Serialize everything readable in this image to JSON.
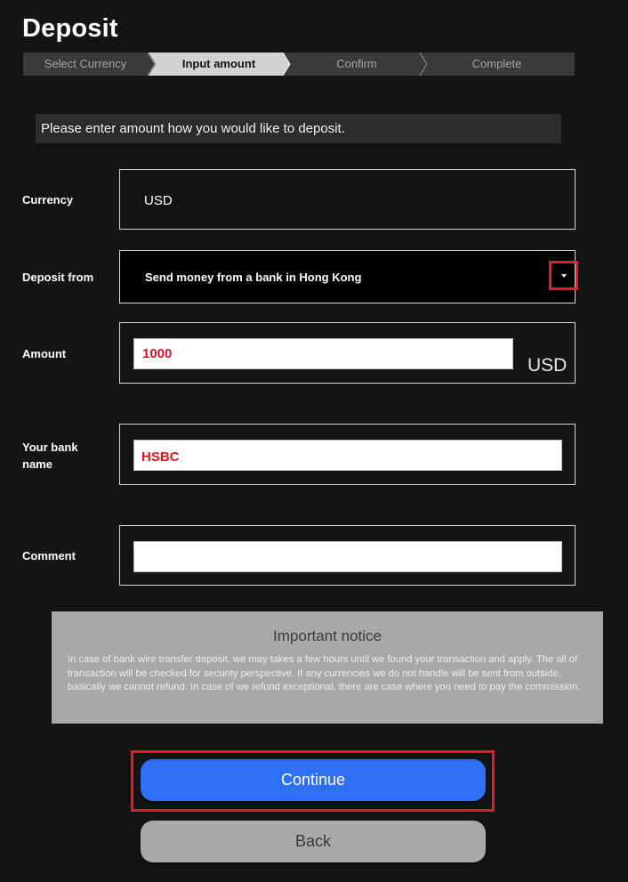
{
  "page": {
    "title": "Deposit"
  },
  "steps": [
    {
      "label": "Select Currency",
      "active": false
    },
    {
      "label": "Input amount",
      "active": true
    },
    {
      "label": "Confirm",
      "active": false
    },
    {
      "label": "Complete",
      "active": false
    }
  ],
  "instruction": "Please enter amount how you would like to deposit.",
  "form": {
    "currency": {
      "label": "Currency",
      "value": "USD"
    },
    "deposit_from": {
      "label": "Deposit from",
      "selected": "Send money from a bank in Hong Kong"
    },
    "amount": {
      "label": "Amount",
      "value": "1000",
      "unit": "USD"
    },
    "bank_name": {
      "label_line1": "Your bank",
      "label_line2": "name",
      "value": "HSBC"
    },
    "comment": {
      "label": "Comment",
      "value": ""
    }
  },
  "notice": {
    "title": "Important notice",
    "body": "In case of bank wire transfer deposit, we may takes a few hours until we found your transaction and apply. The all of transaction will be checked for security perspective. If any currencies we do not handle will be sent from outside, basically we cannot refund. In case of we refund exceptional, there are case where you need to pay the commission."
  },
  "buttons": {
    "continue": "Continue",
    "back": "Back"
  },
  "colors": {
    "accent": "#2f6ff3",
    "highlight": "#e51c24",
    "value_text": "#e1141e"
  }
}
